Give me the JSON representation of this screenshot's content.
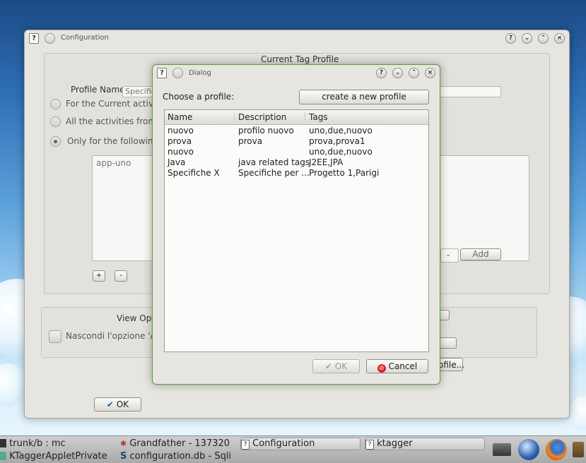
{
  "config_window": {
    "title": "Configuration",
    "heading": "Current Tag Profile",
    "profile_name_label": "Profile Name",
    "profile_name_value": "Specific",
    "radio_current": "For the Current activity",
    "radio_all": "All the activities from n",
    "radio_only": "Only for the following a",
    "activity_item": "app-uno",
    "add_label": "Add",
    "plus_label": "+",
    "minus_label": "-",
    "view_options_label": "View Opti",
    "hide_option_label": "Nascondi l'opzione 'Alt",
    "profile_btn_label": "ofile...",
    "ok_label": "OK"
  },
  "dialog": {
    "title": "Dialog",
    "choose_label": "Choose a profile:",
    "create_button": "create a new profile",
    "columns": [
      "Name",
      "Description",
      "Tags"
    ],
    "rows": [
      {
        "name": "nuovo",
        "description": "profilo nuovo",
        "tags": "uno,due,nuovo"
      },
      {
        "name": "prova",
        "description": "prova",
        "tags": "prova,prova1"
      },
      {
        "name": "nuovo",
        "description": "",
        "tags": "uno,due,nuovo"
      },
      {
        "name": "Java",
        "description": "java related tags",
        "tags": "J2EE,JPA"
      },
      {
        "name": "Specifiche X",
        "description": "Specifiche per ...",
        "tags": "Progetto 1,Parigi"
      }
    ],
    "ok_label": "OK",
    "cancel_label": "Cancel"
  },
  "taskbar": {
    "tasks": [
      {
        "label": "trunk/b : mc",
        "icon": "terminal-icon"
      },
      {
        "label": "Grandfather - 137320",
        "icon": "bug-icon"
      },
      {
        "label": "Configuration",
        "icon": "question-icon"
      },
      {
        "label": "ktagger",
        "icon": "question-icon"
      },
      {
        "label": "KTaggerAppletPrivate",
        "icon": "app-icon"
      },
      {
        "label": "configuration.db - Sqli",
        "icon": "sqlite-icon"
      }
    ],
    "tray_icons": [
      "network-icon",
      "thunderbird-icon",
      "firefox-icon",
      "clipboard-icon"
    ]
  }
}
